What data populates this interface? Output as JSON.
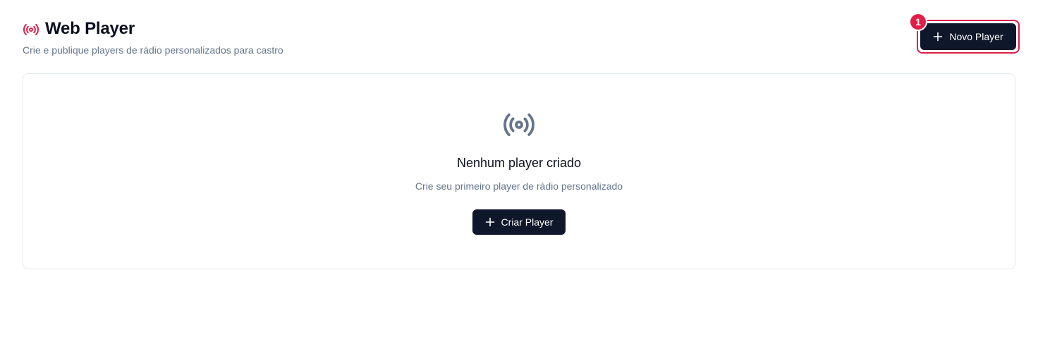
{
  "header": {
    "title": "Web Player",
    "subtitle": "Crie e publique players de rádio personalizados para castro",
    "icon": "broadcast-icon"
  },
  "actions": {
    "new_player_label": "Novo Player",
    "badge_number": "1"
  },
  "empty_state": {
    "icon": "broadcast-icon",
    "title": "Nenhum player criado",
    "subtitle": "Crie seu primeiro player de rádio personalizado",
    "create_label": "Criar Player"
  },
  "colors": {
    "accent": "#e11d48",
    "button_bg": "#0f172a",
    "muted_text": "#64748b",
    "icon_gray": "#64748b",
    "border": "#e2e8f0"
  }
}
